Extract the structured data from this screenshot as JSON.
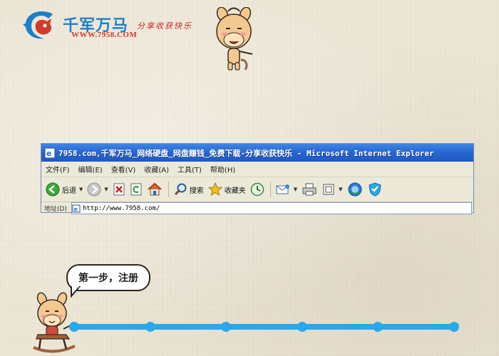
{
  "brand": {
    "name": "千军万马",
    "url": "WWW.7958.COM",
    "slogan": "分享收获快乐"
  },
  "browser": {
    "title": "7958.com,千军万马_网络硬盘_网盘赚钱_免费下载-分享收获快乐 - Microsoft Internet Explorer",
    "menu": [
      "文件(F)",
      "编辑(E)",
      "查看(V)",
      "收藏(A)",
      "工具(T)",
      "帮助(H)"
    ],
    "toolbar": {
      "back_label": "后退",
      "search_label": "搜索",
      "favorites_label": "收藏夹"
    },
    "address": {
      "label": "地址(D)",
      "value": "http://www.7958.com/"
    }
  },
  "step": {
    "text": "第一步，注册"
  },
  "colors": {
    "accent": "#29a8ea",
    "titlebar": "#2a67d2",
    "brand_blue": "#1e7fc9",
    "brand_red": "#d23a2a"
  },
  "icons": [
    "logo-mark",
    "ie-page-icon",
    "back-icon",
    "forward-icon",
    "stop-icon",
    "refresh-icon",
    "home-icon",
    "search-icon",
    "favorites-star-icon",
    "history-icon",
    "mail-icon",
    "print-icon",
    "edit-icon",
    "messenger-icon",
    "shield-icon"
  ],
  "progress": {
    "steps_total": 6,
    "current_step": 1
  }
}
